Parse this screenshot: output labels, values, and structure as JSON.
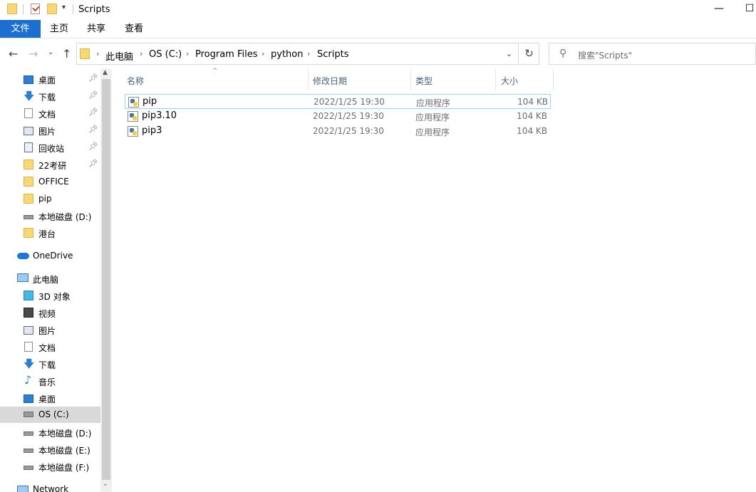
{
  "window": {
    "title": "Scripts",
    "minimize": "—",
    "maximize": "☐"
  },
  "ribbon": {
    "tabs": [
      "文件",
      "主页",
      "共享",
      "查看"
    ]
  },
  "address": {
    "crumbs": [
      "此电脑",
      "OS (C:)",
      "Program Files",
      "python",
      "Scripts"
    ],
    "separator": "›"
  },
  "search": {
    "placeholder": "搜索\"Scripts\""
  },
  "navpane": {
    "quick_access": [
      {
        "label": "桌面",
        "icon": "desktop-icon",
        "pinned": true
      },
      {
        "label": "下载",
        "icon": "download-icon",
        "pinned": true
      },
      {
        "label": "文档",
        "icon": "document-icon",
        "pinned": true
      },
      {
        "label": "图片",
        "icon": "pictures-icon",
        "pinned": true
      },
      {
        "label": "回收站",
        "icon": "recycle-bin-icon",
        "pinned": true
      },
      {
        "label": "22考研",
        "icon": "folder-icon",
        "pinned": true
      },
      {
        "label": "OFFICE",
        "icon": "folder-icon",
        "pinned": false
      },
      {
        "label": "pip",
        "icon": "folder-icon",
        "pinned": false
      },
      {
        "label": "本地磁盘 (D:)",
        "icon": "drive-icon",
        "pinned": false
      },
      {
        "label": "港台",
        "icon": "folder-icon",
        "pinned": false
      }
    ],
    "onedrive": "OneDrive",
    "this_pc": "此电脑",
    "pc_items": [
      {
        "label": "3D 对象",
        "icon": "3d-objects-icon"
      },
      {
        "label": "视频",
        "icon": "video-icon"
      },
      {
        "label": "图片",
        "icon": "pictures-icon"
      },
      {
        "label": "文档",
        "icon": "document-icon"
      },
      {
        "label": "下载",
        "icon": "download-icon"
      },
      {
        "label": "音乐",
        "icon": "music-icon"
      },
      {
        "label": "桌面",
        "icon": "desktop-icon"
      },
      {
        "label": "OS (C:)",
        "icon": "windows-drive-icon",
        "selected": true
      },
      {
        "label": "本地磁盘 (D:)",
        "icon": "drive-icon"
      },
      {
        "label": "本地磁盘 (E:)",
        "icon": "drive-icon"
      },
      {
        "label": "本地磁盘 (F:)",
        "icon": "drive-icon"
      }
    ],
    "network": "Network"
  },
  "filelist": {
    "columns": [
      "名称",
      "修改日期",
      "类型",
      "大小"
    ],
    "rows": [
      {
        "name": "pip",
        "date": "2022/1/25 19:30",
        "type": "应用程序",
        "size": "104 KB",
        "selected": true
      },
      {
        "name": "pip3.10",
        "date": "2022/1/25 19:30",
        "type": "应用程序",
        "size": "104 KB",
        "selected": false
      },
      {
        "name": "pip3",
        "date": "2022/1/25 19:30",
        "type": "应用程序",
        "size": "104 KB",
        "selected": false
      }
    ]
  },
  "colors": {
    "accent": "#1a6fd1",
    "selection_border": "#99d1ff",
    "nav_selected": "#d9d9d9"
  }
}
